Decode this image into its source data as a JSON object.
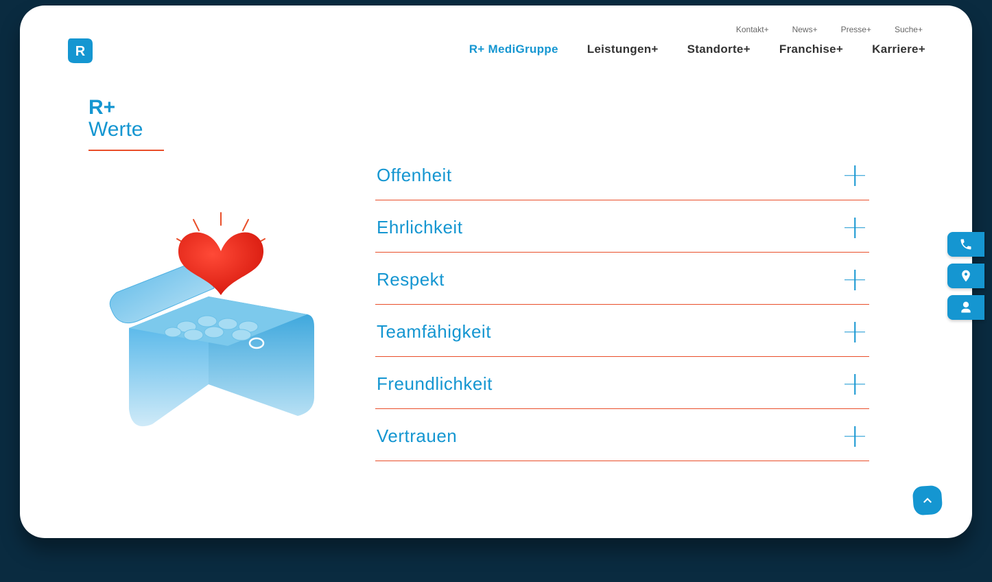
{
  "top_nav": {
    "items": [
      {
        "label": "Kontakt+"
      },
      {
        "label": "News+"
      },
      {
        "label": "Presse+"
      },
      {
        "label": "Suche+"
      }
    ]
  },
  "main_nav": {
    "items": [
      {
        "label": "R+ MediGruppe",
        "active": true
      },
      {
        "label": "Leistungen+"
      },
      {
        "label": "Standorte+"
      },
      {
        "label": "Franchise+"
      },
      {
        "label": "Karriere+"
      }
    ]
  },
  "title": {
    "line1": "R+",
    "line2": "Werte"
  },
  "accordion": {
    "items": [
      {
        "label": "Offenheit"
      },
      {
        "label": "Ehrlichkeit"
      },
      {
        "label": "Respekt"
      },
      {
        "label": "Teamfähigkeit"
      },
      {
        "label": "Freundlichkeit"
      },
      {
        "label": "Vertrauen"
      }
    ]
  },
  "side_tabs": [
    {
      "icon": "phone"
    },
    {
      "icon": "map-pin"
    },
    {
      "icon": "person"
    }
  ],
  "colors": {
    "primary": "#1596d1",
    "accent": "#de1f13",
    "divider": "#e94e29"
  }
}
